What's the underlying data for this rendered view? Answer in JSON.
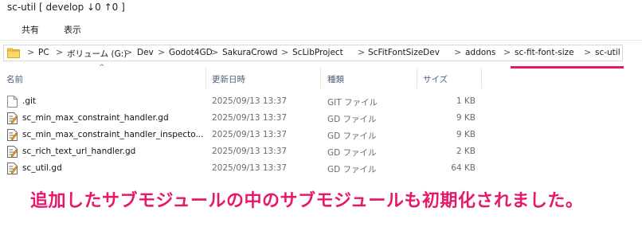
{
  "window": {
    "title": "sc-util [ develop ↓0 ↑0 ]"
  },
  "ribbon": {
    "tabs": [
      "共有",
      "表示"
    ]
  },
  "address_bar": {
    "crumbs": [
      "PC",
      "ボリューム (G:)",
      "Dev",
      "Godot4GD",
      "SakuraCrowd",
      "ScLibProject",
      "ScFitFontSizeDev",
      "addons",
      "sc-fit-font-size",
      "sc-util"
    ],
    "separator": ">"
  },
  "columns": {
    "name": "名前",
    "date": "更新日時",
    "type": "種類",
    "size": "サイズ",
    "sort_indicator": "^"
  },
  "files": [
    {
      "name": ".git",
      "date": "2025/09/13 13:37",
      "type": "GIT ファイル",
      "size": "1 KB",
      "icon": "blank-file-icon"
    },
    {
      "name": "sc_min_max_constraint_handler.gd",
      "date": "2025/09/13 13:37",
      "type": "GD ファイル",
      "size": "9 KB",
      "icon": "gd-file-icon"
    },
    {
      "name": "sc_min_max_constraint_handler_inspecto...",
      "date": "2025/09/13 13:37",
      "type": "GD ファイル",
      "size": "9 KB",
      "icon": "gd-file-icon"
    },
    {
      "name": "sc_rich_text_url_handler.gd",
      "date": "2025/09/13 13:37",
      "type": "GD ファイル",
      "size": "2 KB",
      "icon": "gd-file-icon"
    },
    {
      "name": "sc_util.gd",
      "date": "2025/09/13 13:37",
      "type": "GD ファイル",
      "size": "64 KB",
      "icon": "gd-file-icon"
    }
  ],
  "annotation": {
    "text": "追加したサブモジュールの中のサブモジュールも初期化されました。"
  },
  "colors": {
    "accent": "#e8176b",
    "column_header": "#4c607a"
  }
}
